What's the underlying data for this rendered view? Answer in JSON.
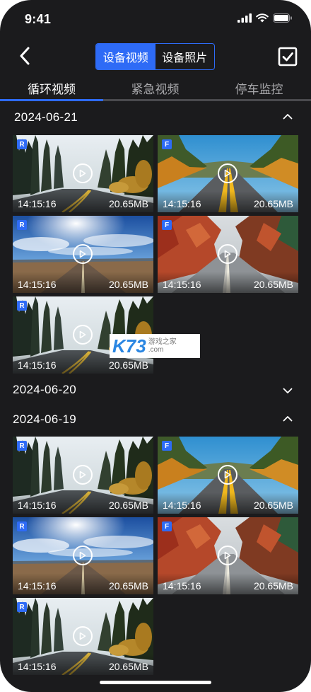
{
  "status_bar": {
    "time": "9:41"
  },
  "nav": {
    "segments": [
      "设备视频",
      "设备照片"
    ],
    "active_segment": 0
  },
  "tabs": [
    "循环视频",
    "紧急视频",
    "停车监控"
  ],
  "groups": [
    {
      "date": "2024-06-21",
      "expanded": true,
      "videos": [
        {
          "badge": "R",
          "scene": "forest-road",
          "time": "14:15:16",
          "size": "20.65MB"
        },
        {
          "badge": "F",
          "scene": "highway-hills",
          "time": "14:15:16",
          "size": "20.65MB"
        },
        {
          "badge": "R",
          "scene": "sky-road",
          "time": "14:15:16",
          "size": "20.65MB"
        },
        {
          "badge": "F",
          "scene": "autumn-road",
          "time": "14:15:16",
          "size": "20.65MB"
        },
        {
          "badge": "R",
          "scene": "forest-road",
          "time": "14:15:16",
          "size": "20.65MB"
        }
      ]
    },
    {
      "date": "2024-06-20",
      "expanded": false,
      "videos": []
    },
    {
      "date": "2024-06-19",
      "expanded": true,
      "videos": [
        {
          "badge": "R",
          "scene": "forest-road",
          "time": "14:15:16",
          "size": "20.65MB"
        },
        {
          "badge": "F",
          "scene": "highway-hills",
          "time": "14:15:16",
          "size": "20.65MB"
        },
        {
          "badge": "R",
          "scene": "sky-road",
          "time": "14:15:16",
          "size": "20.65MB"
        },
        {
          "badge": "F",
          "scene": "autumn-road",
          "time": "14:15:16",
          "size": "20.65MB"
        },
        {
          "badge": "R",
          "scene": "forest-road",
          "time": "14:15:16",
          "size": "20.65MB"
        }
      ]
    }
  ],
  "watermark": {
    "logo": "K73",
    "text": "游戏之家",
    "url_text": ".com"
  },
  "colors": {
    "accent": "#2e6bf6",
    "background": "#1b1b1d"
  }
}
